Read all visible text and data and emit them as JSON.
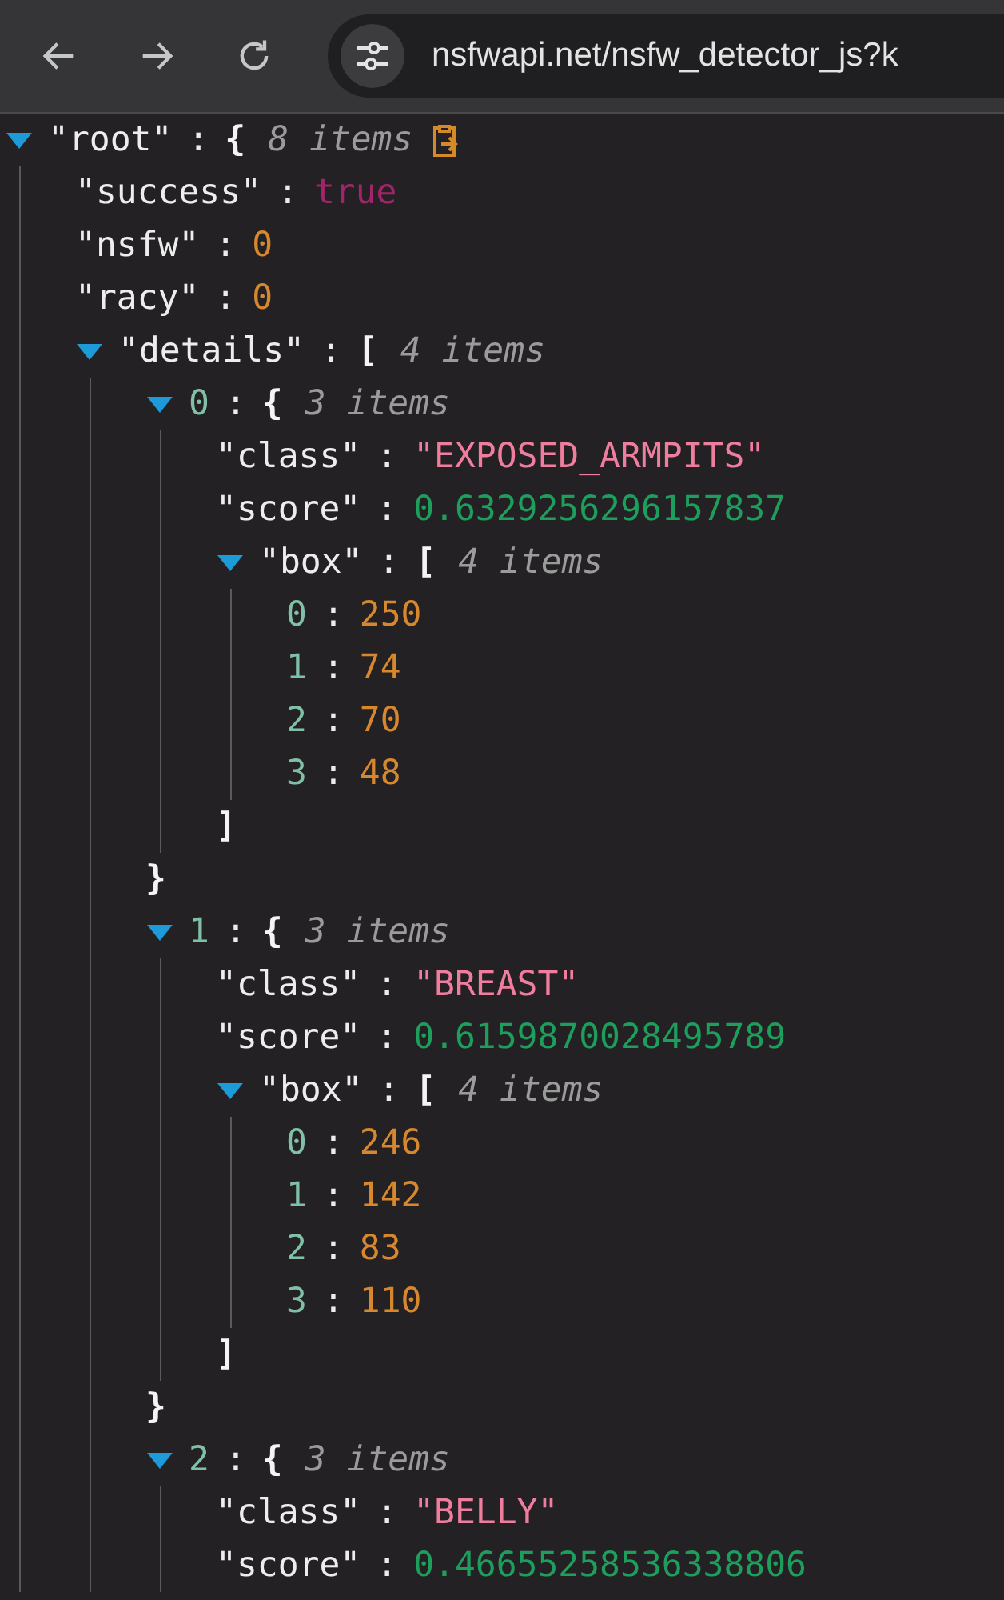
{
  "toolbar": {
    "url": "nsfwapi.net/nsfw_detector_js?k"
  },
  "tree": {
    "key": "\"root\"",
    "sep": ":",
    "kind": "object",
    "open": "{",
    "count": "8 items",
    "expanded": true,
    "children": [
      {
        "key": "\"success\"",
        "sep": ":",
        "kind": "boolean",
        "value": "true"
      },
      {
        "key": "\"nsfw\"",
        "sep": ":",
        "kind": "integer",
        "value": "0"
      },
      {
        "key": "\"racy\"",
        "sep": ":",
        "kind": "integer",
        "value": "0"
      },
      {
        "key": "\"details\"",
        "sep": ":",
        "kind": "array",
        "open": "[",
        "count": "4 items",
        "expanded": true,
        "children": [
          {
            "index": "0",
            "sep": ":",
            "kind": "object",
            "open": "{",
            "count": "3 items",
            "expanded": true,
            "close": "}",
            "children": [
              {
                "key": "\"class\"",
                "sep": ":",
                "kind": "string",
                "value": "\"EXPOSED_ARMPITS\""
              },
              {
                "key": "\"score\"",
                "sep": ":",
                "kind": "float",
                "value": "0.6329256296157837"
              },
              {
                "key": "\"box\"",
                "sep": ":",
                "kind": "array",
                "open": "[",
                "count": "4 items",
                "expanded": true,
                "close": "]",
                "children": [
                  {
                    "index": "0",
                    "sep": ":",
                    "kind": "integer",
                    "value": "250"
                  },
                  {
                    "index": "1",
                    "sep": ":",
                    "kind": "integer",
                    "value": "74"
                  },
                  {
                    "index": "2",
                    "sep": ":",
                    "kind": "integer",
                    "value": "70"
                  },
                  {
                    "index": "3",
                    "sep": ":",
                    "kind": "integer",
                    "value": "48"
                  }
                ]
              }
            ]
          },
          {
            "index": "1",
            "sep": ":",
            "kind": "object",
            "open": "{",
            "count": "3 items",
            "expanded": true,
            "close": "}",
            "children": [
              {
                "key": "\"class\"",
                "sep": ":",
                "kind": "string",
                "value": "\"BREAST\""
              },
              {
                "key": "\"score\"",
                "sep": ":",
                "kind": "float",
                "value": "0.6159870028495789"
              },
              {
                "key": "\"box\"",
                "sep": ":",
                "kind": "array",
                "open": "[",
                "count": "4 items",
                "expanded": true,
                "close": "]",
                "children": [
                  {
                    "index": "0",
                    "sep": ":",
                    "kind": "integer",
                    "value": "246"
                  },
                  {
                    "index": "1",
                    "sep": ":",
                    "kind": "integer",
                    "value": "142"
                  },
                  {
                    "index": "2",
                    "sep": ":",
                    "kind": "integer",
                    "value": "83"
                  },
                  {
                    "index": "3",
                    "sep": ":",
                    "kind": "integer",
                    "value": "110"
                  }
                ]
              }
            ]
          },
          {
            "index": "2",
            "sep": ":",
            "kind": "object",
            "open": "{",
            "count": "3 items",
            "expanded": true,
            "children": [
              {
                "key": "\"class\"",
                "sep": ":",
                "kind": "string",
                "value": "\"BELLY\""
              },
              {
                "key": "\"score\"",
                "sep": ":",
                "kind": "float",
                "value": "0.46655258536338806"
              }
            ]
          }
        ]
      }
    ]
  }
}
